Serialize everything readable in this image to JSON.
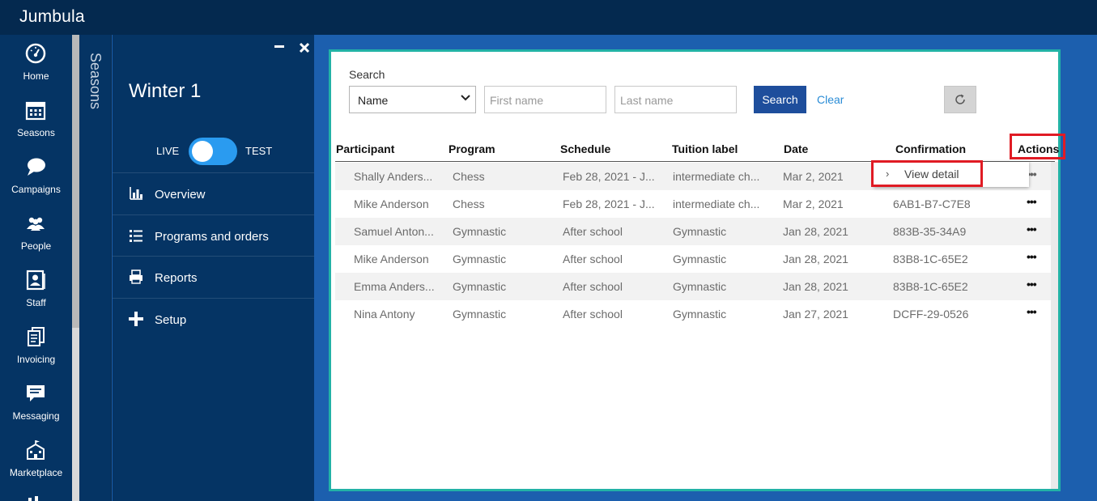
{
  "app": {
    "name": "Jumbula"
  },
  "nav": [
    {
      "id": "home",
      "label": "Home",
      "icon": "dashboard-gauge-icon"
    },
    {
      "id": "seasons",
      "label": "Seasons",
      "icon": "calendar-icon"
    },
    {
      "id": "campaigns",
      "label": "Campaigns",
      "icon": "speech-bubbles-icon"
    },
    {
      "id": "people",
      "label": "People",
      "icon": "people-group-icon"
    },
    {
      "id": "staff",
      "label": "Staff",
      "icon": "staff-badge-icon"
    },
    {
      "id": "invoicing",
      "label": "Invoicing",
      "icon": "invoice-stack-icon"
    },
    {
      "id": "messaging",
      "label": "Messaging",
      "icon": "message-icon"
    },
    {
      "id": "marketplace",
      "label": "Marketplace",
      "icon": "school-building-icon"
    }
  ],
  "seasons_panel": {
    "tab_label": "Seasons",
    "title": "Winter 1",
    "mode": {
      "live": "LIVE",
      "test": "TEST",
      "state": "live"
    },
    "menu": [
      {
        "label": "Overview",
        "icon": "bar-chart-icon"
      },
      {
        "label": "Programs and orders",
        "icon": "list-icon"
      },
      {
        "label": "Reports",
        "icon": "printer-icon"
      },
      {
        "label": "Setup",
        "icon": "plus-icon"
      }
    ]
  },
  "search": {
    "label": "Search",
    "field_select": "Name",
    "first_name_placeholder": "First name",
    "last_name_placeholder": "Last name",
    "search_button": "Search",
    "clear_link": "Clear"
  },
  "table": {
    "columns": [
      "Participant",
      "Program",
      "Schedule",
      "Tuition label",
      "Date",
      "Confirmation",
      "Actions"
    ],
    "rows": [
      {
        "participant": "Shally Anders...",
        "program": "Chess",
        "schedule": "Feb 28, 2021 - J...",
        "tuition": "intermediate ch...",
        "date": "Mar 2, 2021",
        "confirmation": ""
      },
      {
        "participant": "Mike Anderson",
        "program": "Chess",
        "schedule": "Feb 28, 2021 - J...",
        "tuition": "intermediate ch...",
        "date": "Mar 2, 2021",
        "confirmation": "6AB1-B7-C7E8"
      },
      {
        "participant": "Samuel Anton...",
        "program": "Gymnastic",
        "schedule": "After school",
        "tuition": "Gymnastic",
        "date": "Jan 28, 2021",
        "confirmation": "883B-35-34A9"
      },
      {
        "participant": "Mike Anderson",
        "program": "Gymnastic",
        "schedule": "After school",
        "tuition": "Gymnastic",
        "date": "Jan 28, 2021",
        "confirmation": "83B8-1C-65E2"
      },
      {
        "participant": "Emma Anders...",
        "program": "Gymnastic",
        "schedule": "After school",
        "tuition": "Gymnastic",
        "date": "Jan 28, 2021",
        "confirmation": "83B8-1C-65E2"
      },
      {
        "participant": "Nina Antony",
        "program": "Gymnastic",
        "schedule": "After school",
        "tuition": "Gymnastic",
        "date": "Jan 27, 2021",
        "confirmation": "DCFF-29-0526"
      }
    ],
    "row_action": "•••",
    "popup": {
      "chevron": "›",
      "label": "View detail"
    }
  },
  "colors": {
    "topbar": "#04294f",
    "nav_bg": "#053464",
    "workspace": "#1c5fae",
    "frame_border": "#22b2a6",
    "primary_button": "#1e4e9c",
    "toggle": "#2a9bf0",
    "highlight": "#e01b24"
  }
}
